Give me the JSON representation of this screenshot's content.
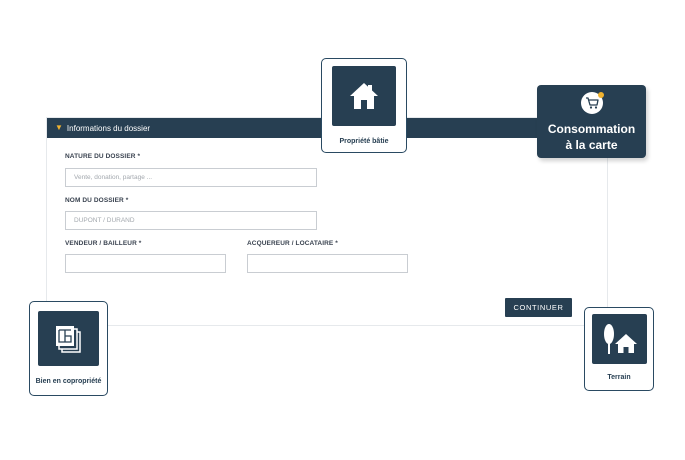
{
  "form": {
    "section_title": "Informations du dossier",
    "nature": {
      "label": "NATURE DU DOSSIER *",
      "placeholder": "Vente, donation, partage ..."
    },
    "nom": {
      "label": "NOM DU DOSSIER *",
      "placeholder": "DUPONT / DURAND"
    },
    "vendeur": {
      "label": "VENDEUR / BAILLEUR *",
      "placeholder": ""
    },
    "acquereur": {
      "label": "ACQUEREUR / LOCATAIRE *",
      "placeholder": ""
    },
    "continue_label": "CONTINUER"
  },
  "cards": {
    "propriete": {
      "label": "Propriété bâtie",
      "icon": "house-icon"
    },
    "copropriete": {
      "label": "Bien en copropriété",
      "icon": "building-plan-icon"
    },
    "terrain": {
      "label": "Terrain",
      "icon": "tree-house-icon"
    }
  },
  "promo": {
    "line1": "Consommation",
    "line2": "à la carte",
    "icon": "cart-icon"
  },
  "colors": {
    "navy": "#273f52",
    "accent": "#f0b330"
  }
}
